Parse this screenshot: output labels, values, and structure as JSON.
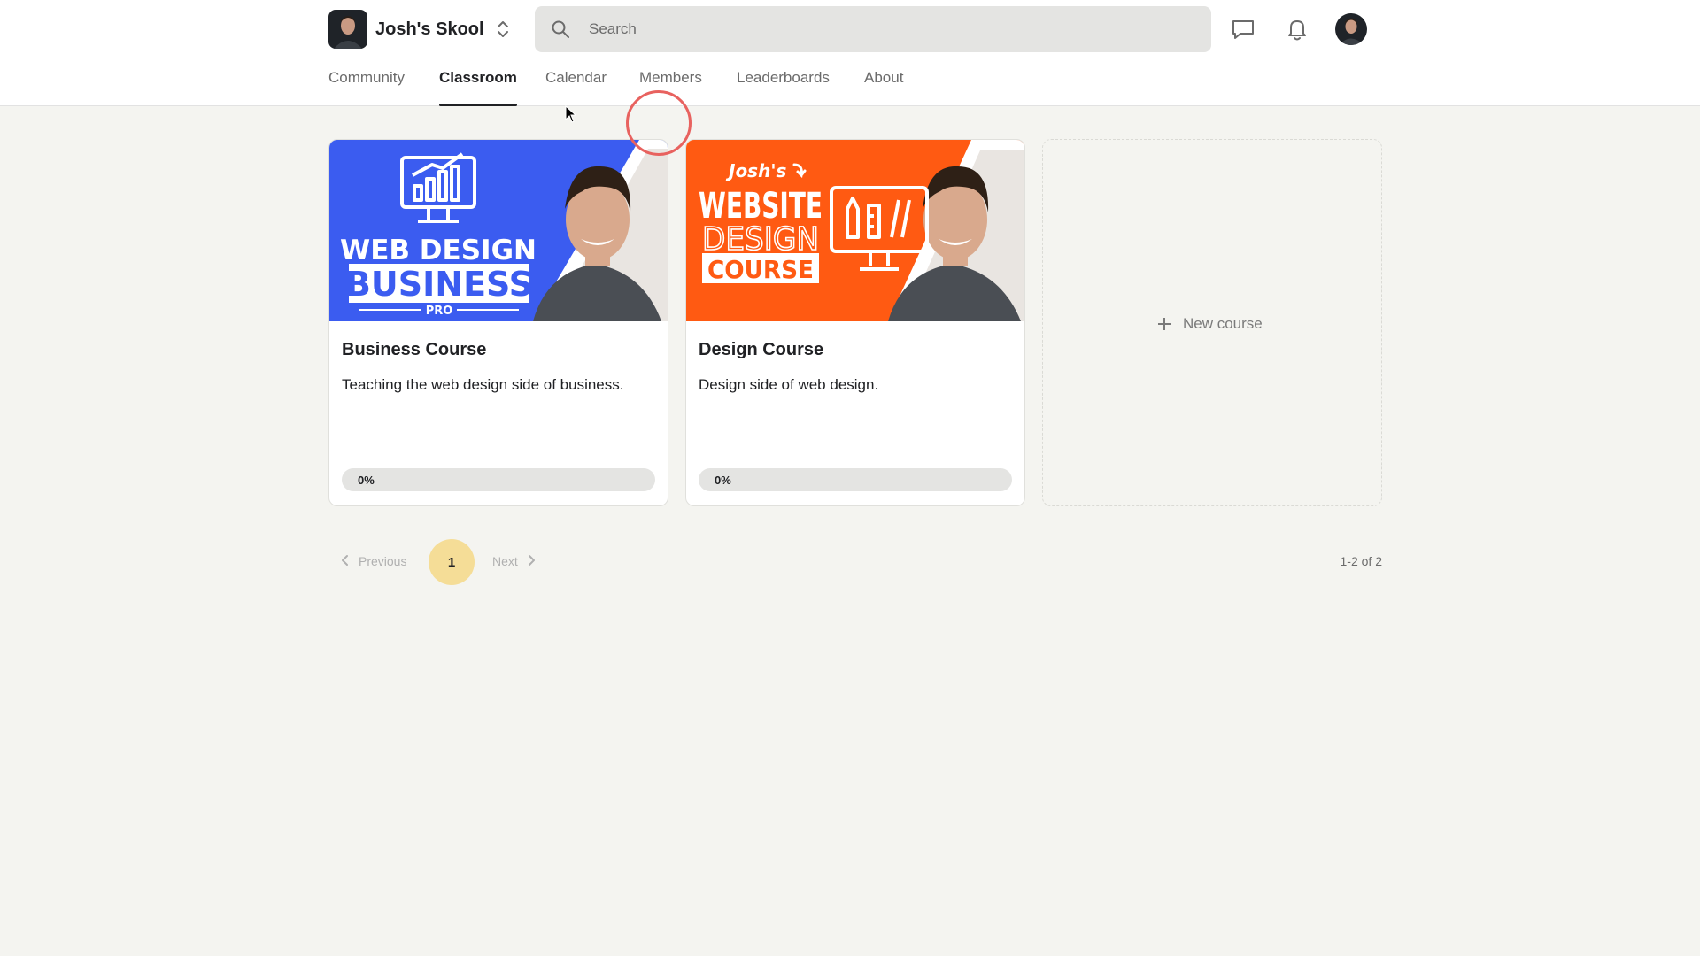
{
  "header": {
    "brand_name": "Josh's Skool",
    "search_placeholder": "Search"
  },
  "nav": {
    "tabs": [
      {
        "label": "Community",
        "active": false
      },
      {
        "label": "Classroom",
        "active": true
      },
      {
        "label": "Calendar",
        "active": false
      },
      {
        "label": "Members",
        "active": false
      },
      {
        "label": "Leaderboards",
        "active": false
      },
      {
        "label": "About",
        "active": false
      }
    ]
  },
  "courses": [
    {
      "title": "Business Course",
      "description": "Teaching the web design side of business.",
      "progress_label": "0%",
      "progress": 0,
      "thumbnail": {
        "line1": "WEB DESIGN",
        "line2": "BUSINESS",
        "line3": "PRO",
        "bg": "#3b5cf0"
      }
    },
    {
      "title": "Design Course",
      "description": "Design side of web design.",
      "progress_label": "0%",
      "progress": 0,
      "thumbnail": {
        "line0": "Josh's",
        "line1": "WEBSITE",
        "line2": "DESIGN",
        "line3": "COURSE",
        "bg": "#ff5a12"
      }
    }
  ],
  "new_course_label": "New course",
  "pagination": {
    "previous": "Previous",
    "current": "1",
    "next": "Next",
    "count": "1-2 of 2"
  },
  "colors": {
    "accent": "#f5dd97",
    "click_indicator": "#e8625f"
  }
}
